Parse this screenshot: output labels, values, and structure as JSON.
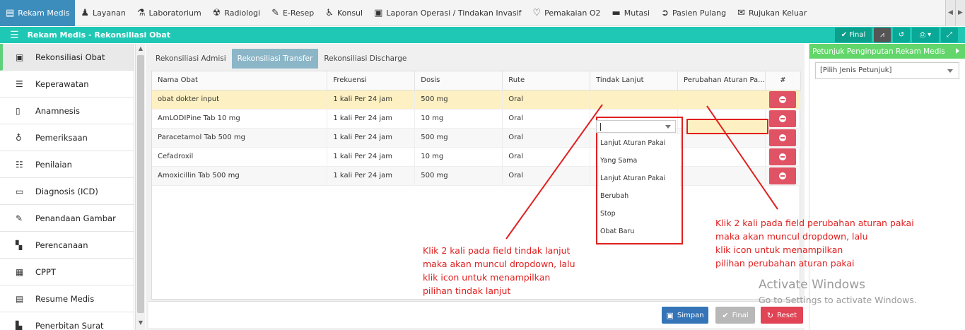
{
  "topnav": {
    "items": [
      {
        "label": "Rekam Medis",
        "icon": "file-icon"
      },
      {
        "label": "Layanan",
        "icon": "user-group-icon"
      },
      {
        "label": "Laboratorium",
        "icon": "flask-icon"
      },
      {
        "label": "Radiologi",
        "icon": "xray-icon"
      },
      {
        "label": "E-Resep",
        "icon": "pill-icon"
      },
      {
        "label": "Konsul",
        "icon": "wheelchair-icon"
      },
      {
        "label": "Laporan Operasi / Tindakan Invasif",
        "icon": "report-icon"
      },
      {
        "label": "Pemakaian O2",
        "icon": "heart-icon"
      },
      {
        "label": "Mutasi",
        "icon": "bed-icon"
      },
      {
        "label": "Pasien Pulang",
        "icon": "arrow-circle-icon"
      },
      {
        "label": "Rujukan Keluar",
        "icon": "envelope-icon"
      }
    ]
  },
  "header": {
    "title": "Rekam Medis - Rekonsiliasi Obat",
    "final_label": "Final"
  },
  "sidebar": {
    "items": [
      {
        "label": "Rekonsiliasi Obat",
        "icon": "medkit-icon"
      },
      {
        "label": "Keperawatan",
        "icon": "list-icon"
      },
      {
        "label": "Anamnesis",
        "icon": "clipboard-icon"
      },
      {
        "label": "Pemeriksaan",
        "icon": "stethoscope-icon"
      },
      {
        "label": "Penilaian",
        "icon": "checklist-icon"
      },
      {
        "label": "Diagnosis (ICD)",
        "icon": "document-icon"
      },
      {
        "label": "Penandaan Gambar",
        "icon": "edit-icon"
      },
      {
        "label": "Perencanaan",
        "icon": "plan-icon"
      },
      {
        "label": "CPPT",
        "icon": "cppt-icon"
      },
      {
        "label": "Resume Medis",
        "icon": "resume-icon"
      },
      {
        "label": "Penerbitan Surat",
        "icon": "letter-icon"
      }
    ]
  },
  "tabs": [
    {
      "label": "Rekonsiliasi Admisi"
    },
    {
      "label": "Rekonsiliasi Transfer"
    },
    {
      "label": "Rekonsiliasi Discharge"
    }
  ],
  "table": {
    "columns": [
      "Nama Obat",
      "Frekuensi",
      "Dosis",
      "Rute",
      "Tindak Lanjut",
      "Perubahan Aturan Pa...",
      "#"
    ],
    "rows": [
      {
        "nama": "obat dokter input",
        "frekuensi": "1 kali Per 24 jam",
        "dosis": "500 mg",
        "rute": "Oral"
      },
      {
        "nama": "AmLODIPine Tab 10 mg",
        "frekuensi": "1 kali Per 24 jam",
        "dosis": "10 mg",
        "rute": "Oral"
      },
      {
        "nama": "Paracetamol Tab 500 mg",
        "frekuensi": "1 kali Per 24 jam",
        "dosis": "500 mg",
        "rute": "Oral"
      },
      {
        "nama": "Cefadroxil",
        "frekuensi": "1 kali Per 24 jam",
        "dosis": "10 mg",
        "rute": "Oral"
      },
      {
        "nama": "Amoxicillin Tab 500 mg",
        "frekuensi": "1 kali Per 24 jam",
        "dosis": "500 mg",
        "rute": "Oral"
      }
    ]
  },
  "dropdown": {
    "options": [
      "Lanjut Aturan Pakai",
      "Yang Sama",
      "Lanjut Aturan Pakai",
      "Berubah",
      "Stop",
      "Obat Baru"
    ]
  },
  "buttons": {
    "simpan": "Simpan",
    "final": "Final",
    "reset": "Reset"
  },
  "right_panel": {
    "title": "Petunjuk Penginputan Rekam Medis",
    "select_value": "[Pilih Jenis Petunjuk]"
  },
  "annotations": {
    "tindak_lanjut": [
      "Klik 2 kali pada field tindak lanjut",
      "maka akan muncul dropdown, lalu",
      "klik icon untuk menampilkan",
      "pilihan tindak lanjut"
    ],
    "perubahan": [
      "Klik 2 kali pada field perubahan aturan pakai",
      "maka akan muncul dropdown, lalu",
      "klik icon untuk menampilkan",
      "pilihan perubahan aturan pakai"
    ]
  },
  "watermark": {
    "line1": "Activate Windows",
    "line2": "Go to Settings to activate Windows."
  },
  "colors": {
    "teal": "#1fc8b4",
    "nav_active": "#3c8dbc",
    "danger": "#e05365",
    "annotation": "#e02020",
    "right_header": "#62d66a"
  }
}
